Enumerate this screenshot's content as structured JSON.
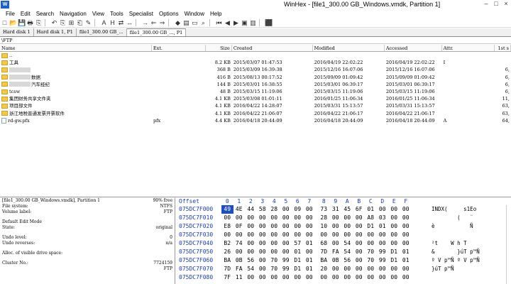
{
  "window": {
    "title": "WinHex - [file1_300.00 GB_Windows.vmdk, Partition 1]",
    "app_icon": "W",
    "controls": [
      "–",
      "□",
      "×"
    ]
  },
  "menu": [
    "File",
    "Edit",
    "Search",
    "Navigation",
    "View",
    "Tools",
    "Specialist",
    "Options",
    "Window",
    "Help"
  ],
  "toolbar_icons": [
    "new-file-icon",
    "open-icon",
    "save-icon",
    "print-icon",
    "properties-icon",
    "sep",
    "undo-icon",
    "copy-icon",
    "copy-block-icon",
    "paste-icon",
    "write-icon",
    "sep",
    "find-text-icon",
    "find-hex-icon",
    "replace-icon",
    "replace-hex-icon",
    "sep",
    "goto-offset-icon",
    "back-icon",
    "forward-icon",
    "sep",
    "disk-icon",
    "ram-icon",
    "ruler-icon",
    "search-icon",
    "sep",
    "first-icon",
    "prev-icon",
    "next-icon",
    "camera-icon",
    "paste-image-icon",
    "sep",
    "help-book-icon"
  ],
  "toolbar_glyphs": [
    "□",
    "📂",
    "💾",
    "🖶",
    "⎘",
    "",
    "↶",
    "⎘",
    "⊞",
    "⎗",
    "✎",
    "",
    "A",
    "H",
    "⇄",
    "↔",
    "",
    "→",
    "⇐",
    "⇒",
    "",
    "◆",
    "▤",
    "▭",
    "⌕",
    "",
    "⏮",
    "◀",
    "▶",
    "▣",
    "▥",
    "",
    "⬛"
  ],
  "tabs": [
    "Hard disk 1",
    "Hard disk 1, P1",
    "file1_300.00 GB_...",
    "file1_300.00 GB_..., P1"
  ],
  "path": "\\FTP",
  "columns": {
    "name": "Name",
    "ext": "Ext.",
    "size": "Size",
    "created": "Created",
    "modified": "Modified",
    "accessed": "Accessed",
    "attr": "Attr.",
    "first": "1st s"
  },
  "rows": [
    {
      "type": "folder",
      "name": "..",
      "ext": "",
      "size": "",
      "created": "",
      "modified": "",
      "accessed": "",
      "attr": "",
      "first": ""
    },
    {
      "type": "folder",
      "name": "工具",
      "ext": "",
      "size": "8.2 KB",
      "created": "2015/03/07   01:47:53",
      "modified": "2016/04/19   22:02:22",
      "accessed": "2016/04/19   22:02:22",
      "attr": "I",
      "first": ""
    },
    {
      "type": "folder",
      "blur": true,
      "name": "",
      "ext": "",
      "size": "368 B",
      "created": "2015/03/09   16:39:38",
      "modified": "2015/12/16   16:07:06",
      "accessed": "2015/12/16   16:07:06",
      "attr": "",
      "first": "6,"
    },
    {
      "type": "folder",
      "blur": true,
      "name": "数据",
      "ext": "",
      "size": "416 B",
      "created": "2015/08/13   00:17:52",
      "modified": "2015/09/09   01:09:42",
      "accessed": "2015/09/09   01:09:42",
      "attr": "",
      "first": "6,"
    },
    {
      "type": "folder",
      "blur": true,
      "name": "汽车经纪",
      "ext": "",
      "size": "144 B",
      "created": "2015/03/01   16:38:55",
      "modified": "2015/03/01   06:39:17",
      "accessed": "2015/03/01   06:39:17",
      "attr": "",
      "first": "6,"
    },
    {
      "type": "folder",
      "name": "tcsw",
      "ext": "",
      "size": "48 B",
      "created": "2015/03/15   11:19:06",
      "modified": "2015/03/15   11:19:06",
      "accessed": "2015/03/15   11:19:06",
      "attr": "",
      "first": "6,"
    },
    {
      "type": "folder",
      "name": "集团财务共享文件夹",
      "ext": "",
      "size": "4.1 KB",
      "created": "2015/03/08   01:01:11",
      "modified": "2016/01/25   11:06:34",
      "accessed": "2016/01/25   11:06:34",
      "attr": "",
      "first": "11,"
    },
    {
      "type": "folder",
      "name": "项目部文件",
      "ext": "",
      "size": "4.1 KB",
      "created": "2016/04/22   14:28:07",
      "modified": "2015/03/31   15:13:57",
      "accessed": "2015/03/31   15:13:57",
      "attr": "",
      "first": "63,"
    },
    {
      "type": "folder",
      "name": "浙江地税普通发票开票软件",
      "ext": "",
      "size": "4.1 KB",
      "created": "2016/04/22   21:06:07",
      "modified": "2016/04/22   21:06:17",
      "accessed": "2016/04/22   21:06:17",
      "attr": "",
      "first": "63,"
    },
    {
      "type": "file",
      "name": "rd-gw.pfx",
      "ext": "pfx",
      "size": "4.4 KB",
      "created": "2016/04/18   20:44:09",
      "modified": "2016/04/18   20:44:09",
      "accessed": "2016/04/18   20:44:09",
      "attr": "A",
      "first": "64,"
    }
  ],
  "info": {
    "lines": [
      {
        "label": "[file1_300.00 GB_Windows.vmdk], Partition 1",
        "value": "90% free"
      },
      {
        "label": "File system:",
        "value": "NTFS"
      },
      {
        "label": "Volume label:",
        "value": "FTP"
      },
      {
        "gap": true
      },
      {
        "label": "Default Edit Mode",
        "value": ""
      },
      {
        "label": "State:",
        "value": "original"
      },
      {
        "gap": true
      },
      {
        "label": "Undo level:",
        "value": "0"
      },
      {
        "label": "Undo reverses:",
        "value": "n/a"
      },
      {
        "gap": true
      },
      {
        "label": "Alloc. of visible drive space:",
        "value": ""
      },
      {
        "gap": true
      },
      {
        "label": "Cluster No.:",
        "value": "7724159"
      },
      {
        "label": "",
        "value": "FTP"
      }
    ]
  },
  "hex": {
    "header_offset": "Offset",
    "header_cols": [
      "0",
      "1",
      "2",
      "3",
      "4",
      "5",
      "6",
      "7",
      "8",
      "9",
      "A",
      "B",
      "C",
      "D",
      "E",
      "F"
    ],
    "rows": [
      {
        "offset": "075DC7F000",
        "bytes": [
          "49",
          "4E",
          "44",
          "58",
          "28",
          "00",
          "09",
          "00",
          "73",
          "31",
          "45",
          "6F",
          "01",
          "00",
          "00",
          "00"
        ],
        "ascii": "INDX(     s1Eo    "
      },
      {
        "offset": "075DC7F010",
        "bytes": [
          "00",
          "00",
          "00",
          "00",
          "00",
          "00",
          "00",
          "00",
          "28",
          "00",
          "00",
          "00",
          "A8",
          "03",
          "00",
          "00"
        ],
        "ascii": "        (   ¨   "
      },
      {
        "offset": "075DC7F020",
        "bytes": [
          "E8",
          "0F",
          "00",
          "00",
          "00",
          "00",
          "00",
          "00",
          "10",
          "00",
          "00",
          "00",
          "D1",
          "01",
          "00",
          "00"
        ],
        "ascii": "è           Ñ   "
      },
      {
        "offset": "075DC7F030",
        "bytes": [
          "00",
          "00",
          "00",
          "00",
          "00",
          "00",
          "00",
          "00",
          "00",
          "00",
          "00",
          "00",
          "00",
          "00",
          "00",
          "00"
        ],
        "ascii": "                "
      },
      {
        "offset": "075DC7F040",
        "bytes": [
          "B2",
          "74",
          "00",
          "00",
          "00",
          "00",
          "57",
          "01",
          "68",
          "00",
          "54",
          "00",
          "00",
          "00",
          "00",
          "00"
        ],
        "ascii": "²t    W h T     "
      },
      {
        "offset": "075DC7F050",
        "bytes": [
          "26",
          "00",
          "00",
          "00",
          "00",
          "00",
          "01",
          "00",
          "7D",
          "FA",
          "54",
          "00",
          "70",
          "99",
          "D1",
          "01"
        ],
        "ascii": "&       }úT p™Ñ "
      },
      {
        "offset": "075DC7F060",
        "bytes": [
          "BA",
          "0B",
          "56",
          "00",
          "70",
          "99",
          "D1",
          "01",
          "BA",
          "0B",
          "56",
          "00",
          "70",
          "99",
          "D1",
          "01"
        ],
        "ascii": "º V p™Ñ º V p™Ñ "
      },
      {
        "offset": "075DC7F070",
        "bytes": [
          "7D",
          "FA",
          "54",
          "00",
          "70",
          "99",
          "D1",
          "01",
          "20",
          "00",
          "00",
          "00",
          "00",
          "00",
          "00",
          "00"
        ],
        "ascii": "}úT p™Ñ         "
      },
      {
        "offset": "075DC7F080",
        "bytes": [
          "7F",
          "11",
          "00",
          "00",
          "00",
          "00",
          "00",
          "00",
          "00",
          "00",
          "00",
          "00",
          "00",
          "00",
          "00",
          "00"
        ],
        "ascii": "                "
      }
    ]
  }
}
